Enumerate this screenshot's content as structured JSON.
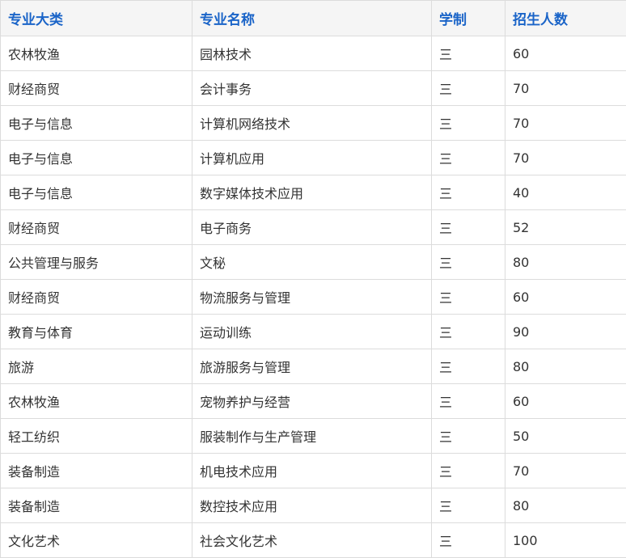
{
  "table": {
    "headers": [
      "专业大类",
      "专业名称",
      "学制",
      "招生人数"
    ],
    "rows": [
      [
        "农林牧渔",
        "园林技术",
        "三",
        "60"
      ],
      [
        "财经商贸",
        "会计事务",
        "三",
        "70"
      ],
      [
        "电子与信息",
        "计算机网络技术",
        "三",
        "70"
      ],
      [
        "电子与信息",
        "计算机应用",
        "三",
        "70"
      ],
      [
        "电子与信息",
        "数字媒体技术应用",
        "三",
        "40"
      ],
      [
        "财经商贸",
        "电子商务",
        "三",
        "52"
      ],
      [
        "公共管理与服务",
        "文秘",
        "三",
        "80"
      ],
      [
        "财经商贸",
        "物流服务与管理",
        "三",
        "60"
      ],
      [
        "教育与体育",
        "运动训练",
        "三",
        "90"
      ],
      [
        "旅游",
        "旅游服务与管理",
        "三",
        "80"
      ],
      [
        "农林牧渔",
        "宠物养护与经营",
        "三",
        "60"
      ],
      [
        "轻工纺织",
        "服装制作与生产管理",
        "三",
        "50"
      ],
      [
        "装备制造",
        "机电技术应用",
        "三",
        "70"
      ],
      [
        "装备制造",
        "数控技术应用",
        "三",
        "80"
      ],
      [
        "文化艺术",
        "社会文化艺术",
        "三",
        "100"
      ]
    ]
  },
  "colors": {
    "header_text": "#1a64c8",
    "header_bg": "#f5f5f5",
    "border": "#dcdcdc",
    "cell_text": "#333333"
  }
}
